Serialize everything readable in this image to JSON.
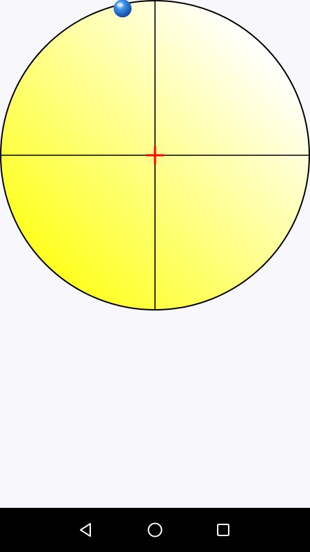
{
  "screen": {
    "background_color": "#f8f7fb"
  },
  "level": {
    "face_gradient": [
      "#ffff20",
      "#ffffff"
    ],
    "outline_color": "#000000",
    "crosshair_color": "#000000",
    "center_marker_color": "#ff0000",
    "bubble": {
      "icon": "bubble-icon",
      "color": "#1e6fd9",
      "offset_x": -0.21,
      "offset_y": -0.95
    }
  },
  "nav_bar": {
    "background_color": "#000000",
    "icon_color": "#ffffff",
    "back_icon": "triangle-back-icon",
    "home_icon": "circle-home-icon",
    "recents_icon": "square-recents-icon"
  }
}
